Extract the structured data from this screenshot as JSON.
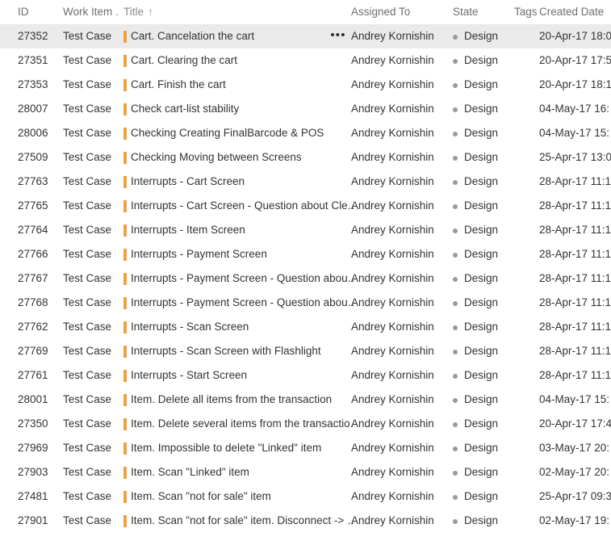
{
  "header": {
    "columns": [
      {
        "key": "id",
        "label": "ID",
        "sorted": false
      },
      {
        "key": "type",
        "label": "Work Item ...",
        "sorted": false
      },
      {
        "key": "title",
        "label": "Title",
        "sorted": true,
        "sort_arrow": "↑"
      },
      {
        "key": "assign",
        "label": "Assigned To",
        "sorted": false
      },
      {
        "key": "state",
        "label": "State",
        "sorted": false
      },
      {
        "key": "tags",
        "label": "Tags",
        "sorted": false
      },
      {
        "key": "created",
        "label": "Created Date",
        "sorted": false
      }
    ]
  },
  "colors": {
    "work_item_type_bar": "#f2a03d",
    "state_dot": "#9a9a9a",
    "selected_row_bg": "#eaeaea",
    "header_text": "#6e6e6e",
    "body_text": "#333333"
  },
  "context_menu_glyph": "•••",
  "rows": [
    {
      "id": "27352",
      "type": "Test Case",
      "title": "Cart. Cancelation the cart",
      "assign": "Andrey Kornishin",
      "state": "Design",
      "tags": "",
      "created": "20-Apr-17 18:0",
      "selected": true
    },
    {
      "id": "27351",
      "type": "Test Case",
      "title": "Cart. Clearing the cart",
      "assign": "Andrey Kornishin",
      "state": "Design",
      "tags": "",
      "created": "20-Apr-17 17:5",
      "selected": false
    },
    {
      "id": "27353",
      "type": "Test Case",
      "title": "Cart. Finish the cart",
      "assign": "Andrey Kornishin",
      "state": "Design",
      "tags": "",
      "created": "20-Apr-17 18:1",
      "selected": false
    },
    {
      "id": "28007",
      "type": "Test Case",
      "title": "Check cart-list stability",
      "assign": "Andrey Kornishin",
      "state": "Design",
      "tags": "",
      "created": "04-May-17 16:",
      "selected": false
    },
    {
      "id": "28006",
      "type": "Test Case",
      "title": "Checking Creating FinalBarcode & POS",
      "assign": "Andrey Kornishin",
      "state": "Design",
      "tags": "",
      "created": "04-May-17 15:",
      "selected": false
    },
    {
      "id": "27509",
      "type": "Test Case",
      "title": "Checking Moving between Screens",
      "assign": "Andrey Kornishin",
      "state": "Design",
      "tags": "",
      "created": "25-Apr-17 13:0",
      "selected": false
    },
    {
      "id": "27763",
      "type": "Test Case",
      "title": "Interrupts - Cart Screen",
      "assign": "Andrey Kornishin",
      "state": "Design",
      "tags": "",
      "created": "28-Apr-17 11:1",
      "selected": false
    },
    {
      "id": "27765",
      "type": "Test Case",
      "title": "Interrupts - Cart Screen - Question about Cle…",
      "assign": "Andrey Kornishin",
      "state": "Design",
      "tags": "",
      "created": "28-Apr-17 11:1",
      "selected": false
    },
    {
      "id": "27764",
      "type": "Test Case",
      "title": "Interrupts - Item Screen",
      "assign": "Andrey Kornishin",
      "state": "Design",
      "tags": "",
      "created": "28-Apr-17 11:1",
      "selected": false
    },
    {
      "id": "27766",
      "type": "Test Case",
      "title": "Interrupts - Payment Screen",
      "assign": "Andrey Kornishin",
      "state": "Design",
      "tags": "",
      "created": "28-Apr-17 11:1",
      "selected": false
    },
    {
      "id": "27767",
      "type": "Test Case",
      "title": "Interrupts - Payment Screen - Question abou…",
      "assign": "Andrey Kornishin",
      "state": "Design",
      "tags": "",
      "created": "28-Apr-17 11:1",
      "selected": false
    },
    {
      "id": "27768",
      "type": "Test Case",
      "title": "Interrupts - Payment Screen - Question abou…",
      "assign": "Andrey Kornishin",
      "state": "Design",
      "tags": "",
      "created": "28-Apr-17 11:1",
      "selected": false
    },
    {
      "id": "27762",
      "type": "Test Case",
      "title": "Interrupts - Scan Screen",
      "assign": "Andrey Kornishin",
      "state": "Design",
      "tags": "",
      "created": "28-Apr-17 11:1",
      "selected": false
    },
    {
      "id": "27769",
      "type": "Test Case",
      "title": "Interrupts - Scan Screen with Flashlight",
      "assign": "Andrey Kornishin",
      "state": "Design",
      "tags": "",
      "created": "28-Apr-17 11:1",
      "selected": false
    },
    {
      "id": "27761",
      "type": "Test Case",
      "title": "Interrupts - Start Screen",
      "assign": "Andrey Kornishin",
      "state": "Design",
      "tags": "",
      "created": "28-Apr-17 11:1",
      "selected": false
    },
    {
      "id": "28001",
      "type": "Test Case",
      "title": "Item. Delete all items from the transaction",
      "assign": "Andrey Kornishin",
      "state": "Design",
      "tags": "",
      "created": "04-May-17 15:",
      "selected": false
    },
    {
      "id": "27350",
      "type": "Test Case",
      "title": "Item. Delete several items from the transactio‥",
      "assign": "Andrey Kornishin",
      "state": "Design",
      "tags": "",
      "created": "20-Apr-17 17:4",
      "selected": false
    },
    {
      "id": "27969",
      "type": "Test Case",
      "title": "Item. Impossible to delete \"Linked\" item",
      "assign": "Andrey Kornishin",
      "state": "Design",
      "tags": "",
      "created": "03-May-17 20:",
      "selected": false
    },
    {
      "id": "27903",
      "type": "Test Case",
      "title": "Item. Scan \"Linked\" item",
      "assign": "Andrey Kornishin",
      "state": "Design",
      "tags": "",
      "created": "02-May-17 20:",
      "selected": false
    },
    {
      "id": "27481",
      "type": "Test Case",
      "title": "Item. Scan \"not for sale\" item",
      "assign": "Andrey Kornishin",
      "state": "Design",
      "tags": "",
      "created": "25-Apr-17 09:3",
      "selected": false
    },
    {
      "id": "27901",
      "type": "Test Case",
      "title": "Item. Scan \"not for sale\" item. Disconnect -> …",
      "assign": "Andrey Kornishin",
      "state": "Design",
      "tags": "",
      "created": "02-May-17 19:",
      "selected": false
    }
  ]
}
